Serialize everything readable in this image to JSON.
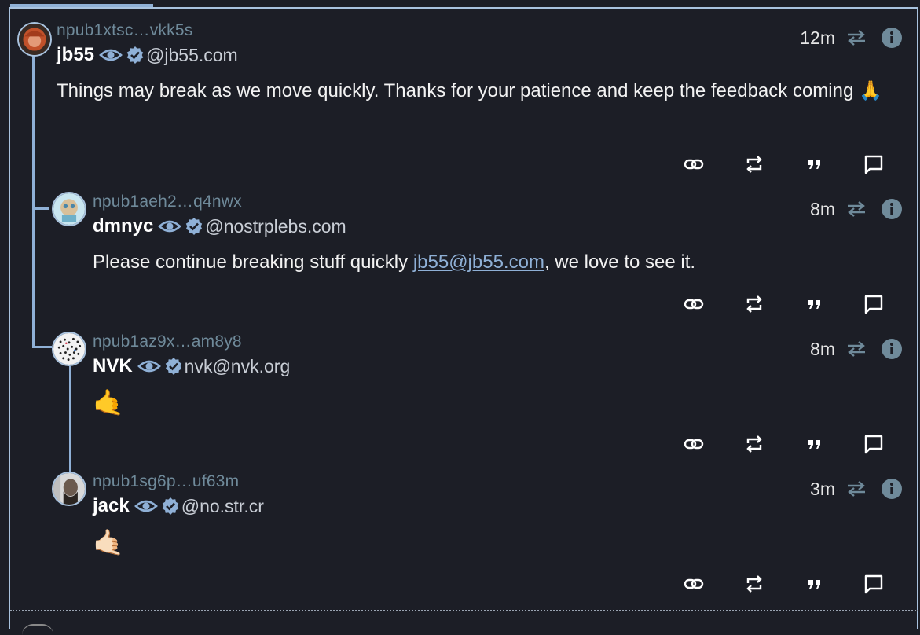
{
  "colors": {
    "background": "#1c1e26",
    "accent": "#8fb0d6",
    "npub": "#6f8a9a",
    "link": "#8fb0d6"
  },
  "icons": {
    "verified": "verified-badge-icon",
    "follow": "eye-icon",
    "repost": "repost-icon",
    "info": "info-icon",
    "share": "link-icon",
    "quote": "quote-icon",
    "reply": "reply-icon"
  },
  "notes": [
    {
      "npub": "npub1xtsc…vkk5s",
      "name": "jb55",
      "nip05": "@jb55.com",
      "time": "12m",
      "content": "Things may break as we move quickly. Thanks for your patience and keep the feedback coming 🙏"
    },
    {
      "npub": "npub1aeh2…q4nwx",
      "name": "dmnyc",
      "nip05": "@nostrplebs.com",
      "time": "8m",
      "content_pre": "Please continue breaking stuff quickly ",
      "content_link": "jb55@jb55.com",
      "content_post": ", we love to see it."
    },
    {
      "npub": "npub1az9x…am8y8",
      "name": "NVK",
      "nip05": "nvk@nvk.org",
      "time": "8m",
      "content": "🤙"
    },
    {
      "npub": "npub1sg6p…uf63m",
      "name": "jack",
      "nip05": "@no.str.cr",
      "time": "3m",
      "content": "🤙🏻"
    }
  ]
}
